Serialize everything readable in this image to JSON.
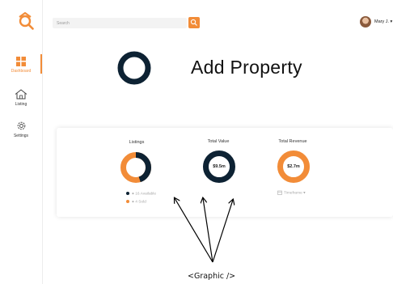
{
  "colors": {
    "accent": "#f28c38",
    "navy": "#0d2233"
  },
  "sidebar": {
    "logo_icon": "house-search-logo-icon",
    "items": [
      {
        "label": "Dashboard",
        "icon": "dashboard-grid-icon",
        "active": true
      },
      {
        "label": "Listing",
        "icon": "house-outline-icon",
        "active": false
      },
      {
        "label": "Settings",
        "icon": "gear-icon",
        "active": false
      }
    ]
  },
  "header": {
    "search_placeholder": "Search",
    "search_icon": "search-icon",
    "user_name": "Mary J. ▾"
  },
  "main": {
    "title": "Add Property"
  },
  "stats": {
    "listings": {
      "label": "Listings",
      "available_fraction": 0.45,
      "legend": [
        {
          "label": "● 16 Available",
          "color": "#0d2233"
        },
        {
          "label": "● 4 Sold",
          "color": "#f28c38"
        }
      ]
    },
    "total_value": {
      "label": "Total Value",
      "value": "$9.5m"
    },
    "total_revenue": {
      "label": "Total Revenue",
      "value": "$2.7m",
      "timeframe": "Timeframe   ▾"
    }
  },
  "annotation": {
    "label": "<Graphic />"
  }
}
